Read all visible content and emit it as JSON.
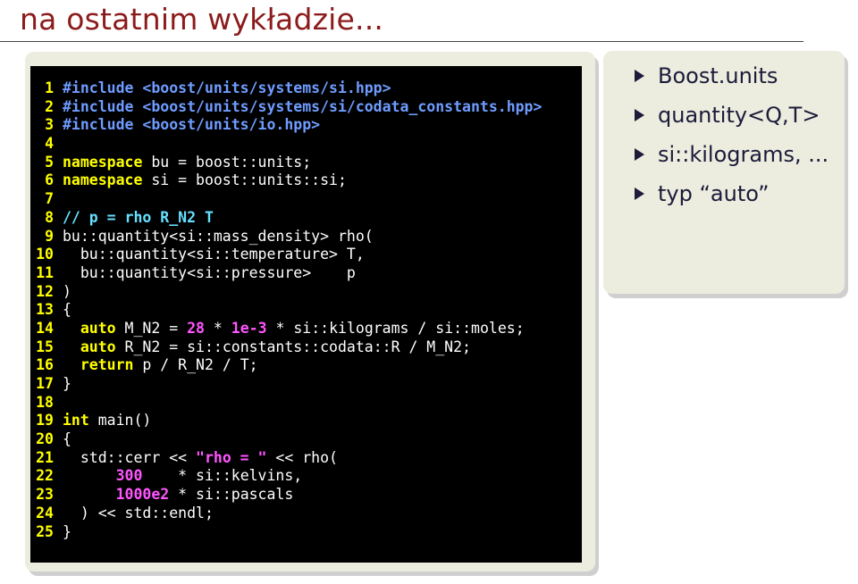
{
  "slide": {
    "title": "na ostatnim wykładzie..."
  },
  "code": [
    [
      [
        "pp",
        "#include <boost/units/systems/si.hpp>"
      ]
    ],
    [
      [
        "pp",
        "#include <boost/units/systems/si/codata_constants.hpp>"
      ]
    ],
    [
      [
        "pp",
        "#include <boost/units/io.hpp>"
      ]
    ],
    [],
    [
      [
        "kw",
        "namespace"
      ],
      [
        "pl",
        " bu = boost::units;"
      ]
    ],
    [
      [
        "kw",
        "namespace"
      ],
      [
        "pl",
        " si = boost::units::si;"
      ]
    ],
    [],
    [
      [
        "cm",
        "// p = rho R_N2 T"
      ]
    ],
    [
      [
        "pl",
        "bu::quantity<si::mass_density> rho("
      ]
    ],
    [
      [
        "pl",
        "  bu::quantity<si::temperature> T,"
      ]
    ],
    [
      [
        "pl",
        "  bu::quantity<si::pressure>    p"
      ]
    ],
    [
      [
        "pl",
        ")"
      ]
    ],
    [
      [
        "pl",
        "{"
      ]
    ],
    [
      [
        "pl",
        "  "
      ],
      [
        "kw",
        "auto"
      ],
      [
        "pl",
        " M_N2 = "
      ],
      [
        "num",
        "28"
      ],
      [
        "pl",
        " * "
      ],
      [
        "num",
        "1e-3"
      ],
      [
        "pl",
        " * si::kilograms / si::moles;"
      ]
    ],
    [
      [
        "pl",
        "  "
      ],
      [
        "kw",
        "auto"
      ],
      [
        "pl",
        " R_N2 = si::constants::codata::R / M_N2;"
      ]
    ],
    [
      [
        "pl",
        "  "
      ],
      [
        "kw",
        "return"
      ],
      [
        "pl",
        " p / R_N2 / T;"
      ]
    ],
    [
      [
        "pl",
        "}"
      ]
    ],
    [],
    [
      [
        "kw",
        "int"
      ],
      [
        "pl",
        " main()"
      ]
    ],
    [
      [
        "pl",
        "{"
      ]
    ],
    [
      [
        "pl",
        "  std::cerr << "
      ],
      [
        "str",
        "\"rho = \""
      ],
      [
        "pl",
        " << rho("
      ]
    ],
    [
      [
        "pl",
        "      "
      ],
      [
        "num",
        "300"
      ],
      [
        "pl",
        "    * si::kelvins,"
      ]
    ],
    [
      [
        "pl",
        "      "
      ],
      [
        "num",
        "1000e2"
      ],
      [
        "pl",
        " * si::pascals"
      ]
    ],
    [
      [
        "pl",
        "  ) << std::endl;"
      ]
    ],
    [
      [
        "pl",
        "}"
      ]
    ]
  ],
  "bullets": [
    "Boost.units",
    "quantity<Q,T>",
    "si::kilograms, ...",
    "typ “auto”"
  ],
  "colors": {
    "title": "#8c1b1b",
    "code_background": "#000000",
    "line_number": "#ffff00",
    "preprocessor": "#6f9cff",
    "keyword": "#ffff00",
    "comment": "#66e0ff",
    "number": "#ff55ff"
  }
}
